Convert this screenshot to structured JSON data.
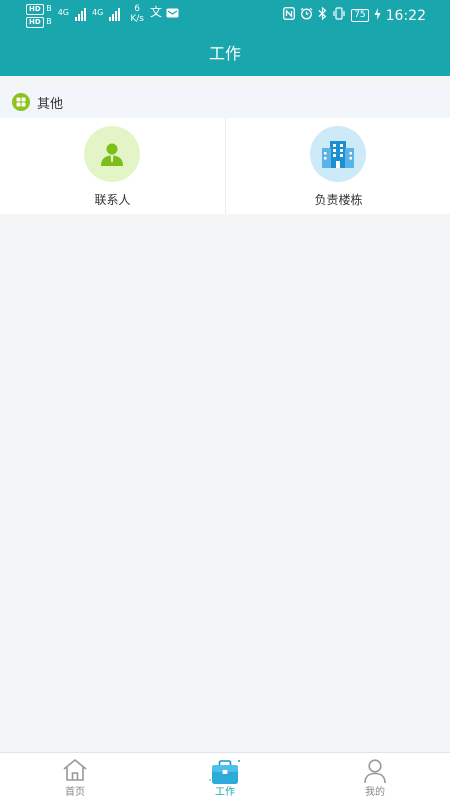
{
  "status_bar": {
    "hd_labels": [
      "HD",
      "HD"
    ],
    "sub_labels": [
      "B",
      "B"
    ],
    "network_labels": [
      "4G",
      "4G"
    ],
    "speed_value": "6",
    "speed_unit": "K/s",
    "battery": "75",
    "time": "16:22"
  },
  "header": {
    "title": "工作"
  },
  "section": {
    "title": "其他"
  },
  "grid": {
    "items": [
      {
        "label": "联系人",
        "icon": "contact-person-icon"
      },
      {
        "label": "负责楼栋",
        "icon": "building-icon"
      }
    ]
  },
  "tabbar": {
    "tabs": [
      {
        "label": "首页",
        "icon": "home-icon"
      },
      {
        "label": "工作",
        "icon": "briefcase-icon",
        "active": true
      },
      {
        "label": "我的",
        "icon": "user-icon"
      }
    ]
  },
  "colors": {
    "primary": "#19a6ad",
    "section_icon_bg": "#8dc21f",
    "contact_circle_bg": "#e3f5c6",
    "building_circle_bg": "#cdeaf8",
    "building_color": "#1a8fd2"
  }
}
